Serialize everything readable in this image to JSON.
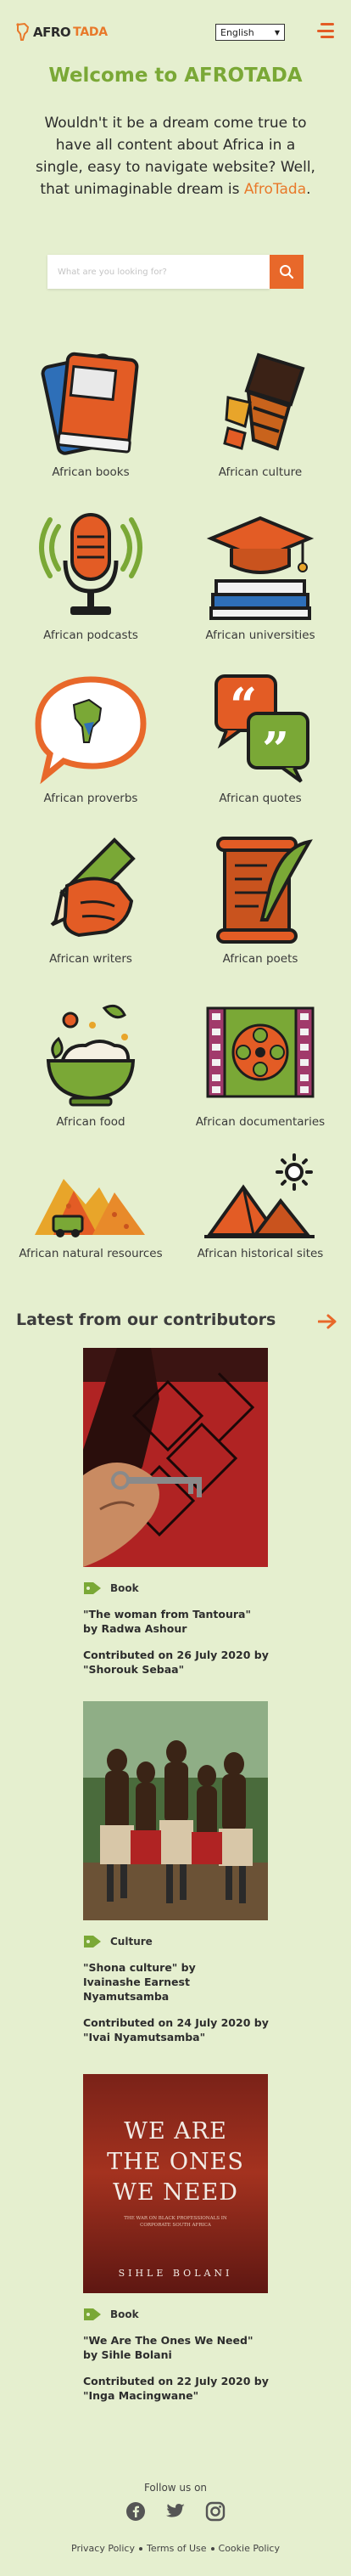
{
  "header": {
    "logo_text_1": "AFRO",
    "logo_text_2": "TADA",
    "language": "English"
  },
  "hero": {
    "title": "Welcome to AFROTADA",
    "text": "Wouldn't it be a dream come true to have all content about Africa in a single, easy to navigate website? Well, that unimaginable dream is",
    "brand": "AfroTada",
    "period": "."
  },
  "search": {
    "placeholder": "What are you looking for?"
  },
  "categories": [
    {
      "label": "African books",
      "icon": "books-icon"
    },
    {
      "label": "African culture",
      "icon": "drum-icon"
    },
    {
      "label": "African podcasts",
      "icon": "microphone-icon"
    },
    {
      "label": "African universities",
      "icon": "graduation-cap-icon"
    },
    {
      "label": "African proverbs",
      "icon": "speech-bubble-icon"
    },
    {
      "label": "African quotes",
      "icon": "quotes-icon"
    },
    {
      "label": "African writers",
      "icon": "pen-hand-icon"
    },
    {
      "label": "African poets",
      "icon": "scroll-quill-icon"
    },
    {
      "label": "African food",
      "icon": "food-bowl-icon"
    },
    {
      "label": "African documentaries",
      "icon": "film-reel-icon"
    },
    {
      "label": "African natural resources",
      "icon": "mining-icon"
    },
    {
      "label": "African historical sites",
      "icon": "pyramids-icon"
    }
  ],
  "latest": {
    "title": "Latest from our contributors"
  },
  "posts": [
    {
      "tag": "Book",
      "title": "\"The woman from Tantoura\"",
      "author": "by Radwa Ashour",
      "contributed": "Contributed on 26 July 2020 by",
      "contributor": "\"Shorouk Sebaa\""
    },
    {
      "tag": "Culture",
      "title": "\"Shona culture\" by",
      "author": "Ivainashe Earnest Nyamutsamba",
      "contributed": "Contributed on 24 July 2020 by",
      "contributor": "\"Ivai Nyamutsamba\""
    },
    {
      "tag": "Book",
      "title": "\"We Are The Ones We Need\"",
      "author": "by Sihle Bolani",
      "contributed": "Contributed on 22 July 2020 by",
      "contributor": "\"Inga Macingwane\"",
      "cover_line_1": "WE ARE",
      "cover_line_2": "THE ONES",
      "cover_line_3": "WE NEED",
      "cover_sub": "THE WAR ON BLACK PROFESSIONALS IN CORPORATE SOUTH AFRICA",
      "cover_author": "SIHLE BOLANI"
    }
  ],
  "footer": {
    "follow": "Follow us on",
    "links": [
      "Privacy Policy",
      "Terms of Use",
      "Cookie Policy"
    ]
  },
  "colors": {
    "background": "#e5efcf",
    "accent_orange": "#e8682a",
    "accent_green": "#7aa836"
  }
}
